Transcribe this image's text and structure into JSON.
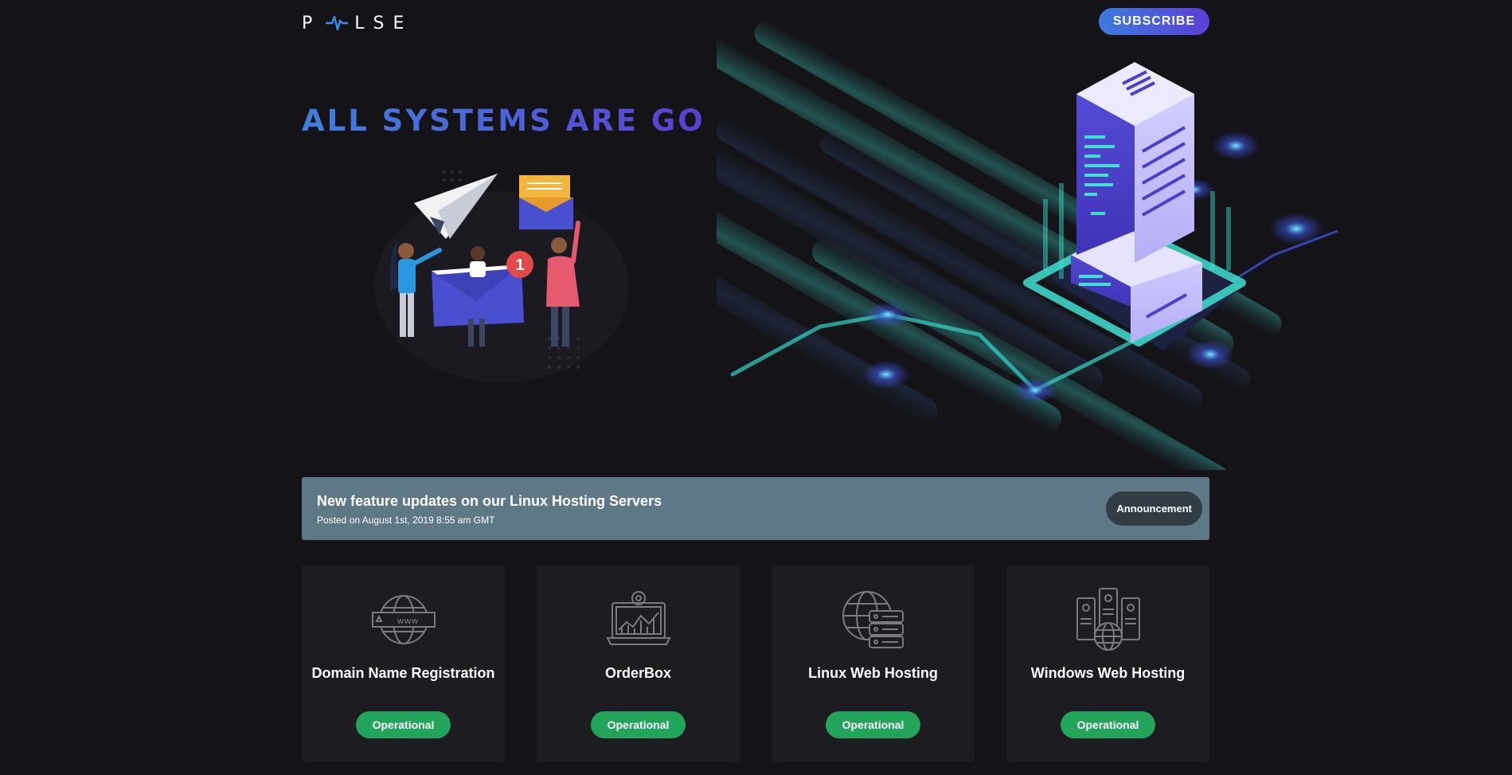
{
  "header": {
    "logo_text": "PULSE",
    "logo_letters": [
      "P",
      "LSE"
    ],
    "subscribe_label": "SUBSCRIBE"
  },
  "hero": {
    "title": "ALL SYSTEMS ARE GO",
    "notification_count": "1"
  },
  "announcement": {
    "title": "New feature updates on our Linux Hosting Servers",
    "posted": "Posted on August 1st, 2019 8:55 am GMT",
    "badge": "Announcement"
  },
  "services": [
    {
      "name": "Domain Name Registration",
      "status": "Operational",
      "icon": "globe-www-icon"
    },
    {
      "name": "OrderBox",
      "status": "Operational",
      "icon": "laptop-gear-chart-icon"
    },
    {
      "name": "Linux Web Hosting",
      "status": "Operational",
      "icon": "globe-server-icon"
    },
    {
      "name": "Windows Web Hosting",
      "status": "Operational",
      "icon": "servers-globe-icon"
    }
  ],
  "colors": {
    "background": "#131318",
    "accent_blue": "#3f7fdc",
    "accent_purple": "#5b3ed2",
    "announcement_bg": "#5f7886",
    "badge_bg": "#313c44",
    "card_bg": "#1c1c21",
    "status_green": "#22a55a",
    "teal": "#3fe0d0"
  }
}
